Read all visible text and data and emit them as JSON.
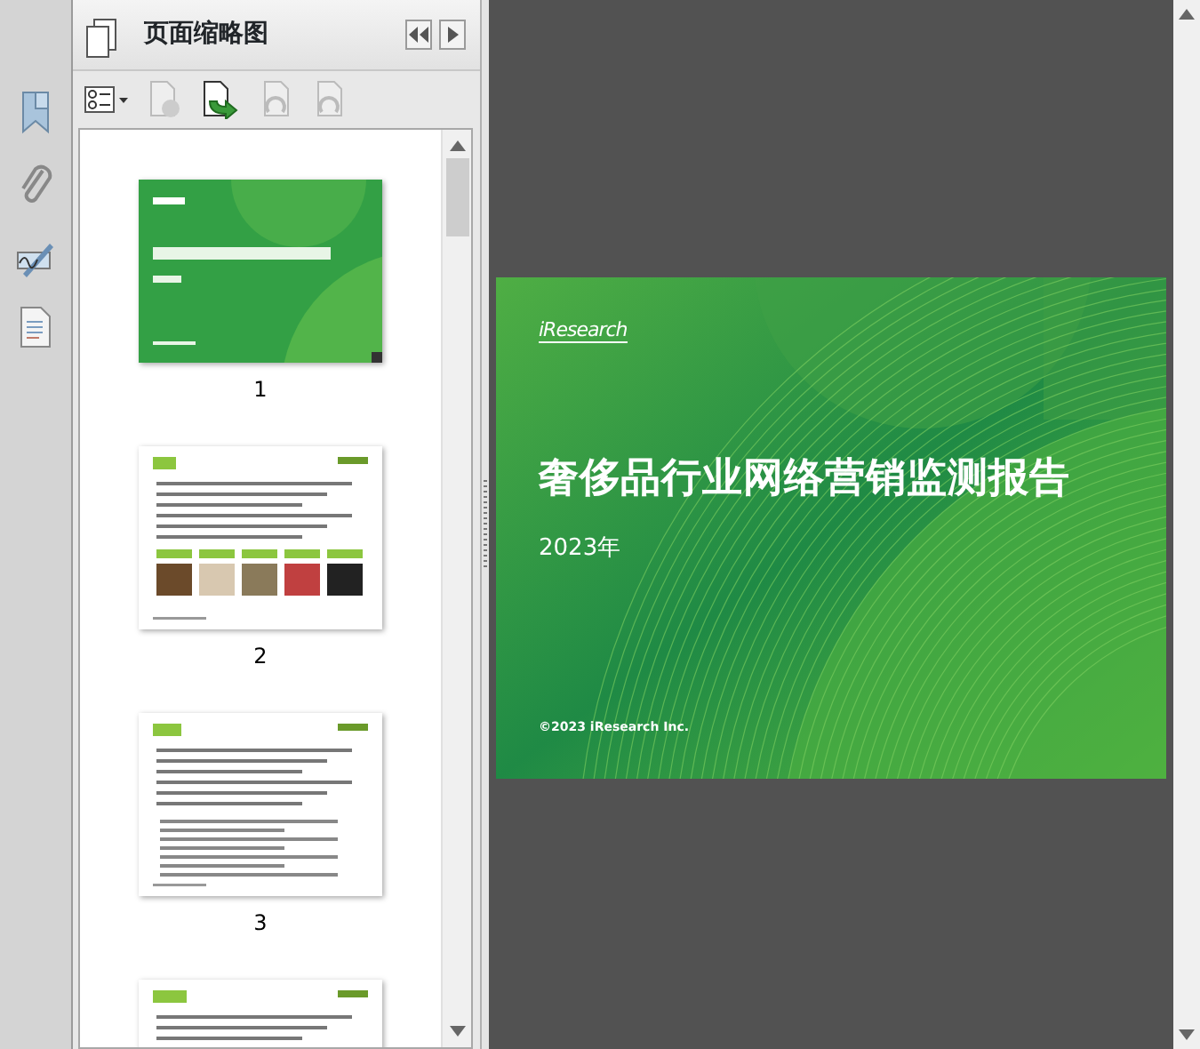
{
  "panel": {
    "title": "页面缩略图"
  },
  "thumbnails": [
    {
      "kind": "cover",
      "page": "1",
      "selected": true
    },
    {
      "kind": "content",
      "page": "2",
      "selected": false
    },
    {
      "kind": "content",
      "page": "3",
      "selected": false
    },
    {
      "kind": "content"
    }
  ],
  "slide": {
    "logo": "iResearch",
    "title": "奢侈品行业网络营销监测报告",
    "year": "2023年",
    "copyright": "©2023 iResearch Inc."
  }
}
